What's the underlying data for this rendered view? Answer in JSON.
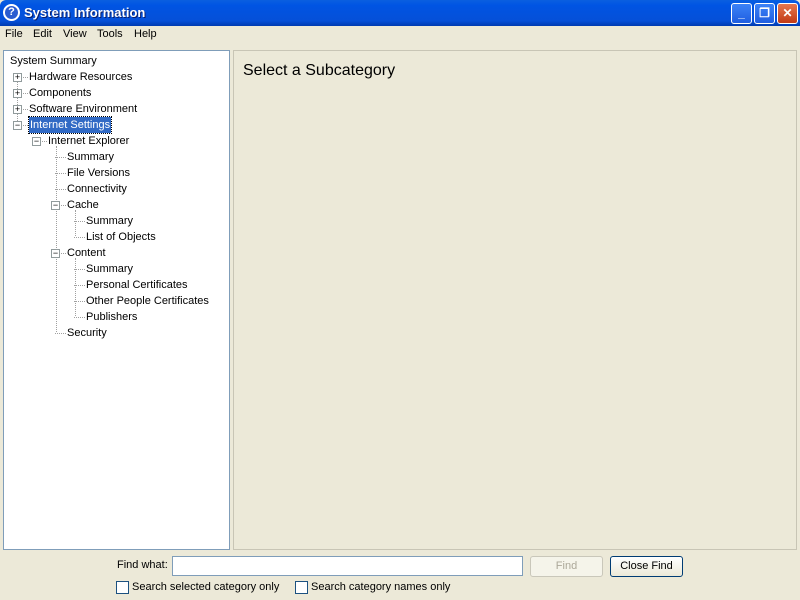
{
  "window": {
    "title": "System Information",
    "icon": "help-question-icon",
    "minimize": "_",
    "restore": "❐",
    "close": "✕"
  },
  "menu": [
    "File",
    "Edit",
    "View",
    "Tools",
    "Help"
  ],
  "tree": [
    {
      "label": "System Summary",
      "level": 0
    },
    {
      "label": "Hardware Resources",
      "level": 1,
      "expander": "+"
    },
    {
      "label": "Components",
      "level": 1,
      "expander": "+"
    },
    {
      "label": "Software Environment",
      "level": 1,
      "expander": "+"
    },
    {
      "label": "Internet Settings",
      "level": 1,
      "expander": "-",
      "selected": true
    },
    {
      "label": "Internet Explorer",
      "level": 2,
      "expander": "-"
    },
    {
      "label": "Summary",
      "level": 3
    },
    {
      "label": "File Versions",
      "level": 3
    },
    {
      "label": "Connectivity",
      "level": 3
    },
    {
      "label": "Cache",
      "level": 3,
      "expander": "-"
    },
    {
      "label": "Summary",
      "level": 4
    },
    {
      "label": "List of Objects",
      "level": 4
    },
    {
      "label": "Content",
      "level": 3,
      "expander": "-"
    },
    {
      "label": "Summary",
      "level": 4
    },
    {
      "label": "Personal Certificates",
      "level": 4
    },
    {
      "label": "Other People Certificates",
      "level": 4
    },
    {
      "label": "Publishers",
      "level": 4
    },
    {
      "label": "Security",
      "level": 3
    }
  ],
  "main": {
    "heading": "Select a Subcategory"
  },
  "find": {
    "label": "Find what:",
    "value": "",
    "find_button": "Find",
    "close_button": "Close Find",
    "opt1": "Search selected category only",
    "opt2": "Search category names only"
  }
}
